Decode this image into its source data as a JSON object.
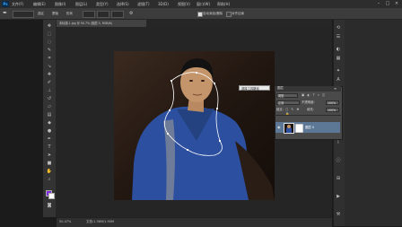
{
  "app": {
    "logo": "Ps"
  },
  "menu": [
    "文件(F)",
    "编辑(E)",
    "图像(I)",
    "图层(L)",
    "类型(Y)",
    "选择(S)",
    "滤镜(T)",
    "3D(D)",
    "视图(V)",
    "窗口(W)",
    "帮助(H)"
  ],
  "window_controls": {
    "minimize": "–",
    "maximize": "□",
    "close": "×"
  },
  "options": {
    "mode_label": "选区",
    "mask_label": "蒙版",
    "shape_label": "形状",
    "auto_add_delete": "自动添加/删除",
    "align_edges": "对齐边缘"
  },
  "document": {
    "tab_title": "未标题-1.jpg @ 50.7% (图层 0, RGB/8)"
  },
  "status": {
    "zoom": "50.47%",
    "doc_size": "文档:1.36M/1.90M"
  },
  "tooltip": {
    "text": "选择工具路径"
  },
  "layers": {
    "tabs": "图层",
    "kind_label": "类型",
    "blend_mode": "正常",
    "opacity_label": "不透明度:",
    "opacity_value": "100%",
    "lock_label": "锁定:",
    "fill_label": "填充:",
    "fill_value": "100%",
    "layer_name": "图层 0"
  },
  "icons": {
    "tools": [
      "move-icon",
      "marquee-icon",
      "lasso-icon",
      "quick-select-icon",
      "crop-icon",
      "eyedropper-icon",
      "healing-icon",
      "brush-icon",
      "stamp-icon",
      "history-brush-icon",
      "eraser-icon",
      "gradient-icon",
      "blur-icon",
      "dodge-icon",
      "pen-icon",
      "type-icon",
      "path-select-icon",
      "shape-icon",
      "hand-icon",
      "zoom-icon"
    ],
    "right": [
      "history-icon",
      "properties-icon",
      "adjustments-icon",
      "swatches-icon",
      "styles-icon",
      "character-icon",
      "paragraph-icon",
      "brushes-icon"
    ]
  },
  "colors": {
    "accent": "#35a7ff",
    "selected_layer": "#5c7896",
    "shirt": "#2c4fa0"
  }
}
